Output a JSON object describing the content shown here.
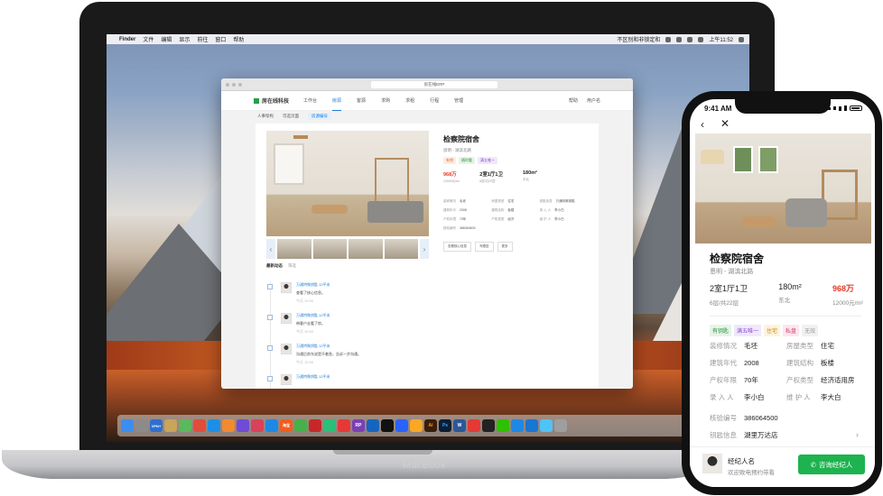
{
  "macbook": {
    "label": "MacBook",
    "menubar": {
      "app": "Finder",
      "items": [
        "文件",
        "编辑",
        "显示",
        "前往",
        "窗口",
        "帮助"
      ],
      "input_method": "不区别和非锁定和",
      "clock": "上午11:52"
    },
    "browser": {
      "url": "房在线ERP",
      "brand": "房在线科技",
      "nav": [
        "工作台",
        "房源",
        "客源",
        "求购",
        "求租",
        "行程",
        "管理"
      ],
      "nav_active": "房源",
      "nav_right": [
        "帮助",
        "用户名"
      ],
      "subnav": [
        "人事架构",
        "可选页面",
        "房源编号"
      ],
      "subnav_active": "房源编号",
      "detail": {
        "title": "检察院宿舍",
        "subtitle": "恩明 - 湖滨北路",
        "tags": [
          "有钥",
          "随时看",
          "满五唯一"
        ],
        "stats": [
          {
            "value": "968万",
            "sub": "12000元/m²"
          },
          {
            "value": "2室1厅1卫",
            "sub": "6层/共22层"
          },
          {
            "value": "180m²",
            "sub": "东北"
          }
        ],
        "fields": [
          {
            "k": "装修情况",
            "v": "毛坯"
          },
          {
            "k": "房屋类型",
            "v": "住宅"
          },
          {
            "k": "钥匙信息",
            "v": "万通特殊钥匙"
          },
          {
            "k": "建筑年代",
            "v": "2008"
          },
          {
            "k": "建筑结构",
            "v": "板楼"
          },
          {
            "k": "录 入 人",
            "v": "李小白"
          },
          {
            "k": "产权年限",
            "v": "70年"
          },
          {
            "k": "产权类型",
            "v": "经济"
          },
          {
            "k": "维 护 人",
            "v": "李小白"
          },
          {
            "k": "核验编号",
            "v": "386064500"
          }
        ],
        "actions": [
          "查看核心信息",
          "写跟进",
          "更多"
        ]
      },
      "feed": {
        "title": "最新动态",
        "filter": "筛选",
        "items": [
          {
            "agent": "万通特殊钥匙 12平米",
            "text": "查看了核心信息。",
            "time": "今天 10:00"
          },
          {
            "agent": "万通特殊钥匙 12平米",
            "text": "带客户去看了房。",
            "time": "今天 10:00"
          },
          {
            "agent": "万通特殊钥匙 12平米",
            "text": "沟通后房东说是不着急，告诉一步沟通。",
            "time": "今天 10:00"
          },
          {
            "agent": "万通特殊钥匙 12平米",
            "text": "",
            "time": ""
          }
        ]
      }
    },
    "dock": [
      "Finder",
      "Launchpad",
      "VPN+",
      "Notes",
      "Maps",
      "Chrome",
      "Safari",
      "Photos",
      "Siri",
      "Music",
      "App Store",
      "淘宝",
      "Messages",
      "招行",
      "Game",
      "Weibo",
      "RP",
      "Chrome2",
      "QQ",
      "Music2",
      "Sketch",
      "Illustrator",
      "Photoshop",
      "Word",
      "Weibo2",
      "QQ2",
      "WeChat",
      "Tool",
      "Security",
      "Finder2",
      "Trash"
    ]
  },
  "phone": {
    "time": "9:41 AM",
    "title": "检察院宿舍",
    "address": "恩明 - 湖滨北路",
    "stats": [
      {
        "value": "2室1厅1卫",
        "sub": "6层/共22层"
      },
      {
        "value": "180m²",
        "sub": "东北"
      },
      {
        "value": "968万",
        "sub": "12000元/m²"
      }
    ],
    "tags": [
      "有钥匙",
      "满五唯一",
      "住宅",
      "私盘",
      "无效"
    ],
    "fields": [
      {
        "k": "装修情况",
        "v": "毛坯"
      },
      {
        "k": "房屋类型",
        "v": "住宅"
      },
      {
        "k": "建筑年代",
        "v": "2008"
      },
      {
        "k": "建筑结构",
        "v": "板楼"
      },
      {
        "k": "产权年限",
        "v": "70年"
      },
      {
        "k": "产权类型",
        "v": "经济适用房"
      },
      {
        "k": "录 入 人",
        "v": "李小白"
      },
      {
        "k": "维 护 人",
        "v": "李大白"
      }
    ],
    "verify": {
      "k": "核验编号",
      "v": "386064500"
    },
    "keys": {
      "k": "钥匙信息",
      "v": "湖里万达店"
    },
    "agent_name": "经纪人名",
    "agent_sub": "欢迎致电预约带看",
    "consult_button": "咨询经纪人"
  }
}
